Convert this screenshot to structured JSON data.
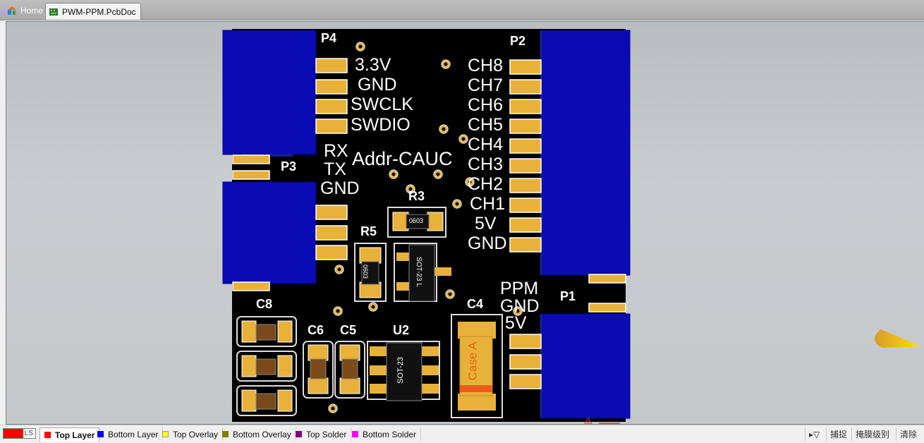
{
  "tabs": [
    {
      "label": "Home",
      "icon": "home-icon"
    },
    {
      "label": "PWM-PPM.PcbDoc",
      "icon": "pcb-doc-icon"
    }
  ],
  "board": {
    "designators": [
      "P4",
      "P2",
      "P3",
      "P1",
      "R3",
      "R5",
      "C8",
      "C6",
      "C5",
      "U2",
      "C4"
    ],
    "p4_labels": [
      "3.3V",
      "GND",
      "SWCLK",
      "SWDIO"
    ],
    "p2_labels": [
      "CH8",
      "CH7",
      "CH6",
      "CH5",
      "CH4",
      "CH3",
      "CH2",
      "CH1",
      "5V",
      "GND"
    ],
    "p3_labels": [
      "RX",
      "TX",
      "GND"
    ],
    "p1_labels": [
      "PPM",
      "GND",
      "5V"
    ],
    "addr_text": "Addr-CAUC",
    "component_marks": {
      "r3": "0603",
      "r5": "0603",
      "sot_r": "SOT-23 L",
      "sot_u2": "SOT-23",
      "case": "Case A"
    }
  },
  "layers": {
    "ls_label": "LS",
    "items": [
      {
        "label": "Top Layer",
        "color": "#ff0000",
        "active": true
      },
      {
        "label": "Bottom Layer",
        "color": "#0000ff"
      },
      {
        "label": "Top Overlay",
        "color": "#ffff00"
      },
      {
        "label": "Bottom Overlay",
        "color": "#808000"
      },
      {
        "label": "Top Solder",
        "color": "#800080"
      },
      {
        "label": "Bottom Solder",
        "color": "#ff00ff"
      }
    ]
  },
  "right_tools": {
    "snap": "捕捉",
    "mask_level": "掩膜级别",
    "clear": "清除"
  }
}
